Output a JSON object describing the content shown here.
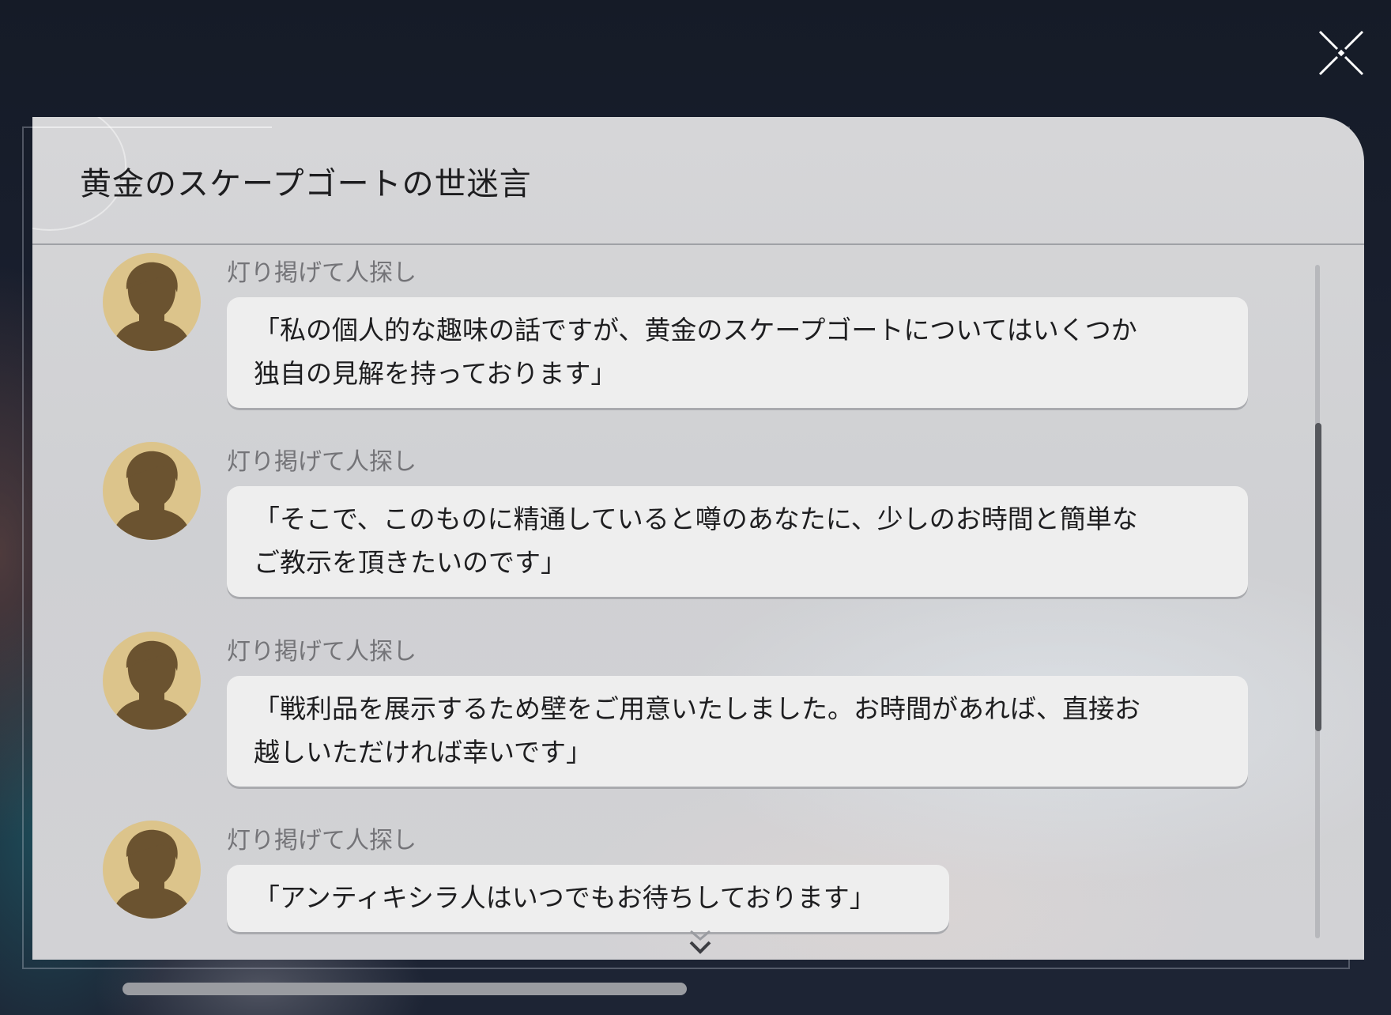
{
  "dialog": {
    "title": "黄金のスケープゴートの世迷言",
    "close_icon": "close-icon",
    "scroll_position_fraction": 0.45
  },
  "messages": [
    {
      "sender": "灯り掲げて人探し",
      "line1": "「私の個人的な趣味の話ですが、黄金のスケープゴートについてはいくつか",
      "line2": "独自の見解を持っております」"
    },
    {
      "sender": "灯り掲げて人探し",
      "line1": "「そこで、このものに精通していると噂のあなたに、少しのお時間と簡単な",
      "line2": "ご教示を頂きたいのです」"
    },
    {
      "sender": "灯り掲げて人探し",
      "line1": "「戦利品を展示するため壁をご用意いたしました。お時間があれば、直接お",
      "line2": "越しいただければ幸いです」"
    },
    {
      "sender": "灯り掲げて人探し",
      "line1": "「アンティキシラ人はいつでもお待ちしております」"
    }
  ],
  "icons": {
    "avatar": "person-silhouette-icon",
    "more": "chevron-double-down-icon"
  },
  "colors": {
    "avatar_bg": "#dcc48b",
    "silhouette": "#6b5330",
    "bubble_bg": "#eeeeee",
    "sender_text": "#747478",
    "panel_bg": "#d3d3d6"
  }
}
